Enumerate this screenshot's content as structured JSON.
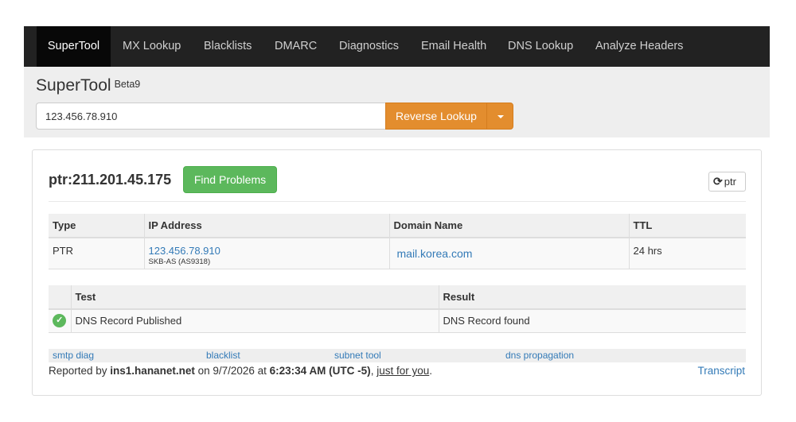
{
  "nav": {
    "items": [
      "SuperTool",
      "MX Lookup",
      "Blacklists",
      "DMARC",
      "Diagnostics",
      "Email Health",
      "DNS Lookup",
      "Analyze Headers"
    ],
    "active": "SuperTool"
  },
  "header": {
    "title": "SuperTool",
    "badge": "Beta9",
    "search_value": "123.456.78.910",
    "lookup_label": "Reverse Lookup"
  },
  "result": {
    "title": "ptr:211.201.45.175",
    "find_problems_label": "Find Problems",
    "refresh_label": "ptr",
    "records": {
      "headers": [
        "Type",
        "IP Address",
        "Domain Name",
        "TTL"
      ],
      "row": {
        "type": "PTR",
        "ip": "123.456.78.910",
        "asn": "SKB-AS (AS9318)",
        "domain": "mail.korea.com",
        "ttl": "24 hrs"
      }
    },
    "tests": {
      "headers": [
        "Test",
        "Result"
      ],
      "row": {
        "test": "DNS Record Published",
        "result": "DNS Record found"
      }
    },
    "links": [
      "smtp diag",
      "blacklist",
      "subnet tool",
      "dns propagation"
    ],
    "footer": {
      "prefix": "Reported by ",
      "server": "ins1.hananet.net",
      "on": " on 9/7/2026 at ",
      "time": "6:23:34 AM (UTC -5)",
      "sep": ", ",
      "just": "just for you",
      "end": ".",
      "transcript": "Transcript"
    }
  },
  "colors": {
    "navbar": "#222222",
    "accent_orange": "#e38d2e",
    "success_green": "#5cb85c",
    "link_blue": "#337ab7"
  }
}
